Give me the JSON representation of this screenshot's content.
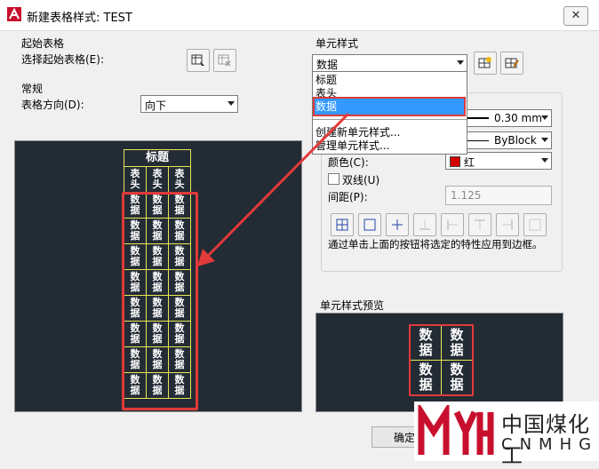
{
  "window": {
    "title": "新建表格样式: TEST",
    "close_glyph": "✕"
  },
  "starting_table": {
    "group_label": "起始表格",
    "select_label": "选择起始表格(E):"
  },
  "general": {
    "group_label": "常规",
    "direction_label": "表格方向(D):",
    "direction_value": "向下"
  },
  "table_preview": {
    "title": "标题",
    "header_row": [
      "表\n头",
      "表\n头",
      "表\n头"
    ],
    "data_cell": "数\n据",
    "data_rows": 8
  },
  "cell_style": {
    "group_label": "单元样式",
    "selected": "数据",
    "options": [
      "标题",
      "表头",
      "数据"
    ],
    "actions": [
      "创建新单元样式...",
      "管理单元样式..."
    ]
  },
  "properties": {
    "lineweight_value": "0.30 mm",
    "linetype_value": "ByBlock",
    "color_label": "颜色(C):",
    "color_value": "红",
    "color_hex": "#d40000",
    "double_line_label": "双线(U)",
    "spacing_label": "间距(P):",
    "spacing_value": "1.125",
    "hint": "通过单击上面的按钮将选定的特性应用到边框。"
  },
  "cell_preview": {
    "label": "单元样式预览",
    "cell": "数\n据"
  },
  "footer": {
    "ok_label": "确定"
  },
  "watermark": {
    "logo": "MYH",
    "name_cn": "中国煤化工",
    "name_en": "CNMHG"
  },
  "colors": {
    "highlight": "#3399ff",
    "annotation_red": "#e03a3a",
    "preview_bg": "#232b35",
    "grid_yellow": "#e8e855"
  }
}
